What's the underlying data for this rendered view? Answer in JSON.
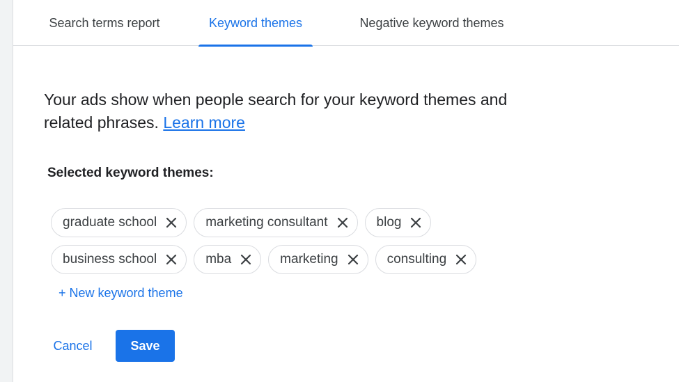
{
  "tabs": [
    {
      "label": "Search terms report"
    },
    {
      "label": "Keyword themes"
    },
    {
      "label": "Negative keyword themes"
    }
  ],
  "description": {
    "text": "Your ads show when people search for your keyword themes and related phrases.",
    "link": "Learn more"
  },
  "selected_label": "Selected keyword themes:",
  "chips": {
    "row1": [
      {
        "label": "graduate school"
      },
      {
        "label": "marketing consultant"
      },
      {
        "label": "blog"
      }
    ],
    "row2": [
      {
        "label": "business school"
      },
      {
        "label": "mba"
      },
      {
        "label": "marketing"
      },
      {
        "label": "consulting"
      }
    ],
    "close_icon": "close-icon"
  },
  "new_keyword_label": "+ New keyword theme",
  "actions": {
    "cancel_label": "Cancel",
    "save_label": "Save"
  },
  "colors": {
    "accent": "#1a73e8",
    "border": "#dadce0",
    "text": "#202124"
  }
}
